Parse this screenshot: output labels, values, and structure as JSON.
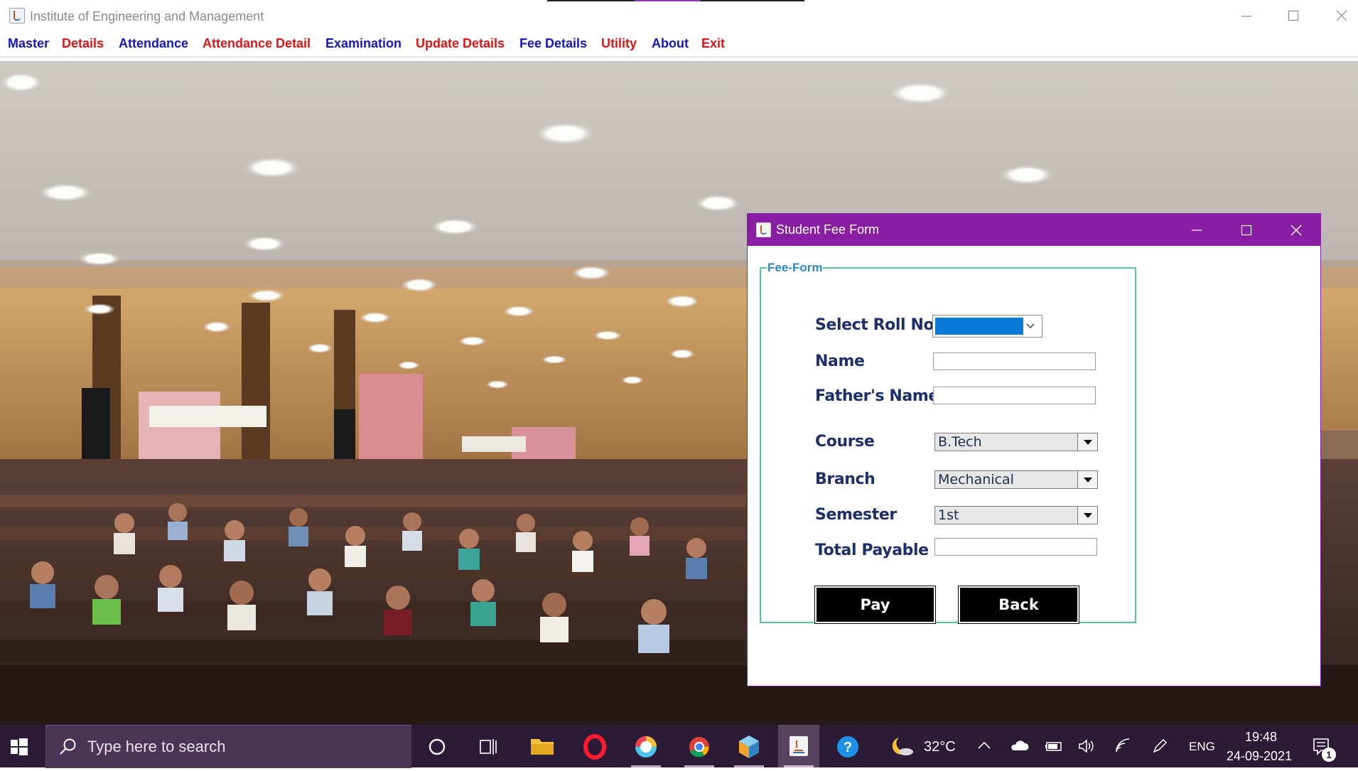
{
  "app": {
    "title": "Institute of Engineering and Management"
  },
  "menu": [
    {
      "label": "Master",
      "color": "#1515c8"
    },
    {
      "label": "Details",
      "color": "#e01414"
    },
    {
      "label": "Attendance",
      "color": "#1515c8"
    },
    {
      "label": "Attendance Detail",
      "color": "#e01414"
    },
    {
      "label": "Examination",
      "color": "#1515c8"
    },
    {
      "label": "Update Details",
      "color": "#e01414"
    },
    {
      "label": "Fee Details",
      "color": "#1515c8"
    },
    {
      "label": "Utility",
      "color": "#e01414"
    },
    {
      "label": "About",
      "color": "#1515c8"
    },
    {
      "label": "Exit",
      "color": "#e01414"
    }
  ],
  "fee_window": {
    "title": "Student Fee Form",
    "group_label": "Fee-Form",
    "labels": {
      "roll": "Select Roll No",
      "name": "Name",
      "father": "Father's Name",
      "course": "Course",
      "branch": "Branch",
      "semester": "Semester",
      "total": "Total Payable"
    },
    "values": {
      "name": "",
      "father": "",
      "course": "B.Tech",
      "branch": "Mechanical",
      "semester": "1st",
      "total": ""
    },
    "buttons": {
      "pay": "Pay",
      "back": "Back"
    }
  },
  "taskbar": {
    "search_placeholder": "Type here to search",
    "weather": "32°C",
    "language": "ENG",
    "time": "19:48",
    "date": "24-09-2021",
    "notification_count": "1"
  },
  "colors": {
    "accent": "#8a1ea2",
    "fieldset_border": "#53c2a3",
    "selection": "#0a79d8"
  }
}
